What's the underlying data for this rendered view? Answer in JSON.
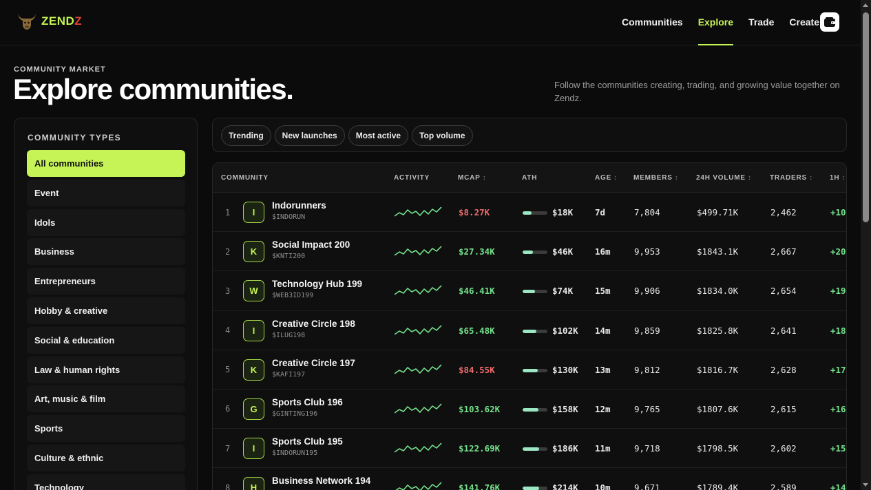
{
  "header": {
    "logo_text_main": "ZEND",
    "logo_text_accent": "Z",
    "nav": [
      {
        "label": "Communities",
        "active": false
      },
      {
        "label": "Explore",
        "active": true
      },
      {
        "label": "Trade",
        "active": false
      },
      {
        "label": "Create",
        "active": false
      }
    ],
    "wallet_icon": "wallet-icon"
  },
  "hero": {
    "eyebrow": "COMMUNITY MARKET",
    "title": "Explore communities.",
    "subtitle": "Follow the communities creating, trading, and growing value together on Zendz."
  },
  "sidebar": {
    "heading": "COMMUNITY TYPES",
    "items": [
      {
        "label": "All communities",
        "active": true
      },
      {
        "label": "Event",
        "active": false
      },
      {
        "label": "Idols",
        "active": false
      },
      {
        "label": "Business",
        "active": false
      },
      {
        "label": "Entrepreneurs",
        "active": false
      },
      {
        "label": "Hobby & creative",
        "active": false
      },
      {
        "label": "Social & education",
        "active": false
      },
      {
        "label": "Law & human rights",
        "active": false
      },
      {
        "label": "Art, music & film",
        "active": false
      },
      {
        "label": "Sports",
        "active": false
      },
      {
        "label": "Culture & ethnic",
        "active": false
      },
      {
        "label": "Technology",
        "active": false
      }
    ]
  },
  "filters": [
    "Trending",
    "New launches",
    "Most active",
    "Top volume"
  ],
  "table": {
    "columns": [
      {
        "label": "COMMUNITY",
        "sortable": false
      },
      {
        "label": "ACTIVITY",
        "sortable": false
      },
      {
        "label": "MCAP",
        "sortable": true
      },
      {
        "label": "ATH",
        "sortable": false
      },
      {
        "label": "AGE",
        "sortable": true
      },
      {
        "label": "MEMBERS",
        "sortable": true
      },
      {
        "label": "24H VOLUME",
        "sortable": true
      },
      {
        "label": "TRADERS",
        "sortable": true
      },
      {
        "label": "1H",
        "sortable": true
      }
    ],
    "sort_glyph": "↕",
    "rows": [
      {
        "rank": "1",
        "initial": "I",
        "name": "Indorunners",
        "ticker": "$INDORUN",
        "mcap": "$8.27K",
        "mcap_dir": "down",
        "ath_progress": 0.35,
        "ath": "$18K",
        "age": "7d",
        "members": "7,804",
        "volume": "$499.71K",
        "traders": "2,462",
        "change": "+10"
      },
      {
        "rank": "2",
        "initial": "K",
        "name": "Social Impact 200",
        "ticker": "$KNTI200",
        "mcap": "$27.34K",
        "mcap_dir": "up",
        "ath_progress": 0.42,
        "ath": "$46K",
        "age": "16m",
        "members": "9,953",
        "volume": "$1843.1K",
        "traders": "2,667",
        "change": "+20"
      },
      {
        "rank": "3",
        "initial": "W",
        "name": "Technology Hub 199",
        "ticker": "$WEB3ID199",
        "mcap": "$46.41K",
        "mcap_dir": "up",
        "ath_progress": 0.5,
        "ath": "$74K",
        "age": "15m",
        "members": "9,906",
        "volume": "$1834.0K",
        "traders": "2,654",
        "change": "+19"
      },
      {
        "rank": "4",
        "initial": "I",
        "name": "Creative Circle 198",
        "ticker": "$ILUG198",
        "mcap": "$65.48K",
        "mcap_dir": "up",
        "ath_progress": 0.55,
        "ath": "$102K",
        "age": "14m",
        "members": "9,859",
        "volume": "$1825.8K",
        "traders": "2,641",
        "change": "+18"
      },
      {
        "rank": "5",
        "initial": "K",
        "name": "Creative Circle 197",
        "ticker": "$KAFI197",
        "mcap": "$84.55K",
        "mcap_dir": "down",
        "ath_progress": 0.6,
        "ath": "$130K",
        "age": "13m",
        "members": "9,812",
        "volume": "$1816.7K",
        "traders": "2,628",
        "change": "+17"
      },
      {
        "rank": "6",
        "initial": "G",
        "name": "Sports Club 196",
        "ticker": "$GINTING196",
        "mcap": "$103.62K",
        "mcap_dir": "up",
        "ath_progress": 0.63,
        "ath": "$158K",
        "age": "12m",
        "members": "9,765",
        "volume": "$1807.6K",
        "traders": "2,615",
        "change": "+16"
      },
      {
        "rank": "7",
        "initial": "I",
        "name": "Sports Club 195",
        "ticker": "$INDORUN195",
        "mcap": "$122.69K",
        "mcap_dir": "up",
        "ath_progress": 0.66,
        "ath": "$186K",
        "age": "11m",
        "members": "9,718",
        "volume": "$1798.5K",
        "traders": "2,602",
        "change": "+15"
      },
      {
        "rank": "8",
        "initial": "H",
        "name": "Business Network 194",
        "ticker": "",
        "mcap": "$141.76K",
        "mcap_dir": "up",
        "ath_progress": 0.68,
        "ath": "$214K",
        "age": "10m",
        "members": "9,671",
        "volume": "$1789.4K",
        "traders": "2,589",
        "change": "+14"
      }
    ]
  },
  "colors": {
    "accent": "#c6f356",
    "positive": "#73e08a",
    "negative": "#ef6b6b"
  }
}
